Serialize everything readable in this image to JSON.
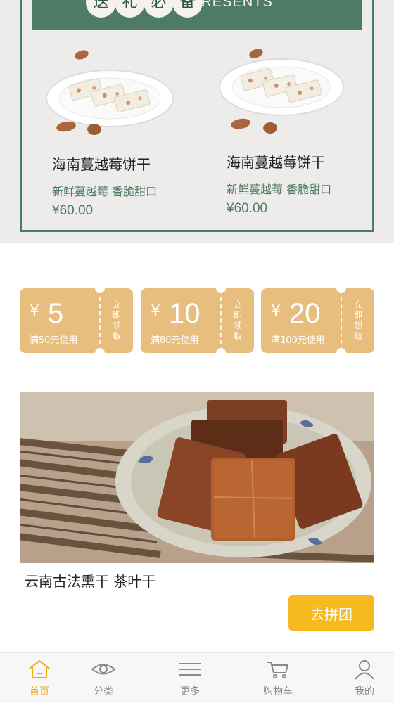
{
  "gift_section": {
    "banner_chars": [
      "送",
      "礼",
      "必",
      "备"
    ],
    "banner_en": "PRESENTS",
    "products": [
      {
        "name": "海南蔓越莓饼干",
        "desc": "新鲜蔓越莓 香脆甜口",
        "price": "¥60.00"
      },
      {
        "name": "海南蔓越莓饼干",
        "desc": "新鲜蔓越莓 香脆甜口",
        "price": "¥60.00"
      }
    ]
  },
  "coupons": [
    {
      "currency": "¥",
      "amount": "5",
      "condition": "满50元使用",
      "claim": [
        "立",
        "即",
        "领",
        "取"
      ]
    },
    {
      "currency": "¥",
      "amount": "10",
      "condition": "满80元使用",
      "claim": [
        "立",
        "即",
        "领",
        "取"
      ]
    },
    {
      "currency": "¥",
      "amount": "20",
      "condition": "满100元使用",
      "claim": [
        "立",
        "即",
        "领",
        "取"
      ]
    }
  ],
  "featured": {
    "title": "云南古法熏干 茶叶干",
    "button": "去拼团"
  },
  "tab_bar": {
    "items": [
      {
        "label": "首页",
        "icon": "home-icon",
        "active": true
      },
      {
        "label": "分类",
        "icon": "eye-icon",
        "active": false
      },
      {
        "label": "更多",
        "icon": "menu-icon",
        "active": false
      },
      {
        "label": "购物车",
        "icon": "cart-icon",
        "active": false
      },
      {
        "label": "我的",
        "icon": "user-icon",
        "active": false
      }
    ]
  },
  "colors": {
    "green": "#4d7b65",
    "coupon": "#e8be7e",
    "accent": "#f7b920",
    "active_tab": "#f0a81a"
  }
}
